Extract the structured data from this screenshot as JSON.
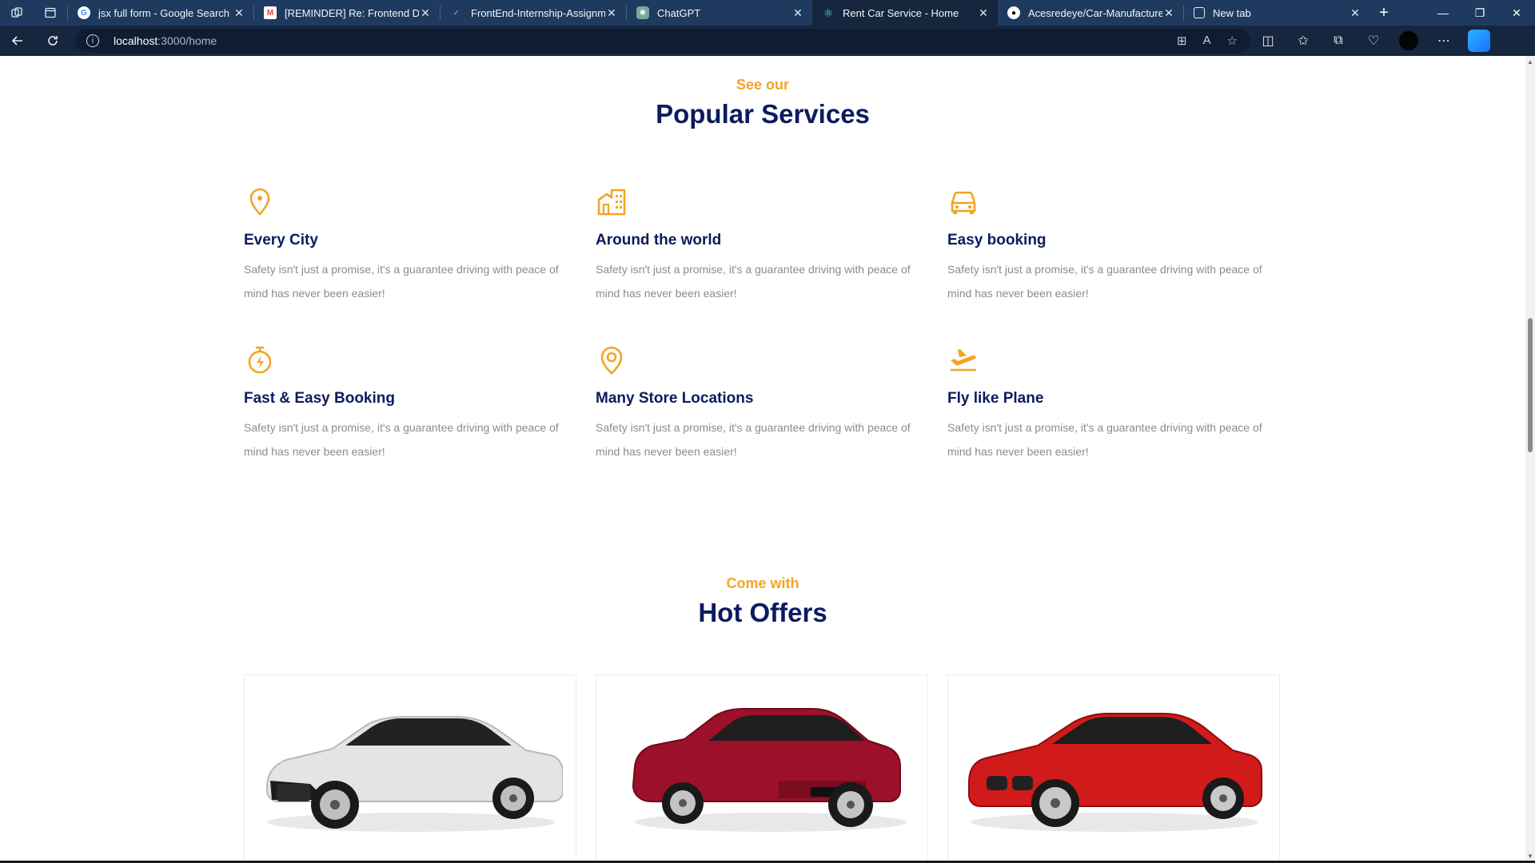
{
  "browser": {
    "tabs": [
      {
        "title": "jsx full form - Google Search",
        "favicon": "google-icon",
        "active": false
      },
      {
        "title": "[REMINDER] Re: Frontend Deve",
        "favicon": "gmail-icon",
        "active": false
      },
      {
        "title": "FrontEnd-Internship-Assignme",
        "favicon": "doc-icon",
        "active": false
      },
      {
        "title": "ChatGPT",
        "favicon": "chatgpt-icon",
        "active": false
      },
      {
        "title": "Rent Car Service - Home",
        "favicon": "react-icon",
        "active": true
      },
      {
        "title": "Acesredeye/Car-Manufacture",
        "favicon": "github-icon",
        "active": false
      },
      {
        "title": "New tab",
        "favicon": "newtab-icon",
        "active": false
      }
    ],
    "url_host": "localhost",
    "url_path": ":3000/home",
    "theme": {
      "tabbar_bg": "#1f3a5f",
      "toolbar_bg": "#16263f"
    }
  },
  "services_section": {
    "eyebrow": "See our",
    "title": "Popular Services",
    "items": [
      {
        "icon": "location-pin-icon",
        "title": "Every City",
        "text": "Safety isn't just a promise, it's a guarantee driving with peace of mind has never been easier!"
      },
      {
        "icon": "building-icon",
        "title": "Around the world",
        "text": "Safety isn't just a promise, it's a guarantee driving with peace of mind has never been easier!"
      },
      {
        "icon": "car-icon",
        "title": "Easy booking",
        "text": "Safety isn't just a promise, it's a guarantee driving with peace of mind has never been easier!"
      },
      {
        "icon": "stopwatch-icon",
        "title": "Fast & Easy Booking",
        "text": "Safety isn't just a promise, it's a guarantee driving with peace of mind has never been easier!"
      },
      {
        "icon": "map-pin-icon",
        "title": "Many Store Locations",
        "text": "Safety isn't just a promise, it's a guarantee driving with peace of mind has never been easier!"
      },
      {
        "icon": "plane-takeoff-icon",
        "title": "Fly like Plane",
        "text": "Safety isn't just a promise, it's a guarantee driving with peace of mind has never been easier!"
      }
    ]
  },
  "offers_section": {
    "eyebrow": "Come with",
    "title": "Hot Offers",
    "cars": [
      {
        "name": "white-sedan",
        "color": "#d9d9d9"
      },
      {
        "name": "red-camry",
        "color": "#a3152b"
      },
      {
        "name": "red-bmw-coupe",
        "color": "#d11a1a"
      }
    ]
  },
  "colors": {
    "accent": "#f4a423",
    "heading": "#0d1b5e",
    "body_text": "#8c8c8c"
  }
}
